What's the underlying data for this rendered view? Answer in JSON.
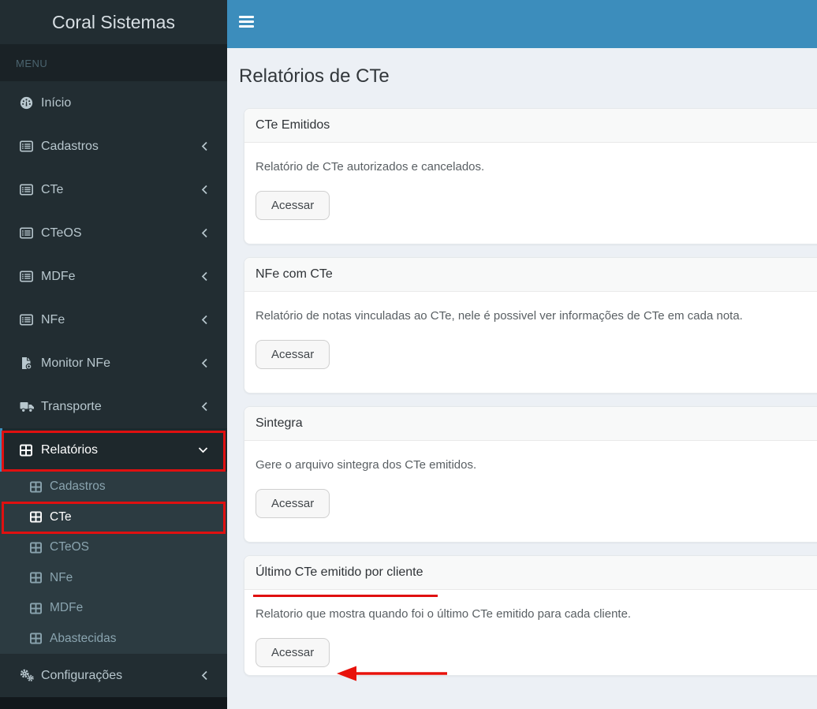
{
  "sidebar": {
    "brand": "Coral Sistemas",
    "section_label": "MENU",
    "items": [
      {
        "label": "Início",
        "icon": "tachometer-icon"
      },
      {
        "label": "Cadastros",
        "icon": "list-icon"
      },
      {
        "label": "CTe",
        "icon": "list-icon"
      },
      {
        "label": "CTeOS",
        "icon": "list-icon"
      },
      {
        "label": "MDFe",
        "icon": "list-icon"
      },
      {
        "label": "NFe",
        "icon": "list-icon"
      },
      {
        "label": "Monitor NFe",
        "icon": "file-plus-icon"
      },
      {
        "label": "Transporte",
        "icon": "truck-icon"
      },
      {
        "label": "Relatórios",
        "icon": "table-icon",
        "state": "expanded-active"
      }
    ],
    "submenu": [
      {
        "label": "Cadastros"
      },
      {
        "label": "CTe",
        "state": "active"
      },
      {
        "label": "CTeOS"
      },
      {
        "label": "NFe"
      },
      {
        "label": "MDFe"
      },
      {
        "label": "Abastecidas"
      }
    ],
    "settings_item": {
      "label": "Configurações",
      "icon": "gears-icon"
    }
  },
  "header": {
    "title": "Relatórios de CTe"
  },
  "cards": [
    {
      "title": "CTe Emitidos",
      "description": "Relatório de CTe autorizados e cancelados.",
      "button": "Acessar"
    },
    {
      "title": "NFe com CTe",
      "description": "Relatório de notas vinculadas ao CTe, nele é possivel ver informações de CTe em cada nota.",
      "button": "Acessar"
    },
    {
      "title": "Sintegra",
      "description": "Gere o arquivo sintegra dos CTe emitidos.",
      "button": "Acessar"
    },
    {
      "title": "Último CTe emitido por cliente",
      "description": "Relatorio que mostra quando foi o último CTe emitido para cada cliente.",
      "button": "Acessar"
    }
  ],
  "annotations": {
    "highlighted_menu": "Relatórios",
    "highlighted_submenu": "CTe",
    "underlined_card_title": "Último CTe emitido por cliente",
    "arrow_target": "Acessar"
  },
  "colors": {
    "navbar_blue": "#3c8dbc",
    "sidebar_dark": "#222d32",
    "sidebar_submenu": "#2c3b41",
    "content_background": "#ecf0f5",
    "annotation_red": "#e01010"
  }
}
